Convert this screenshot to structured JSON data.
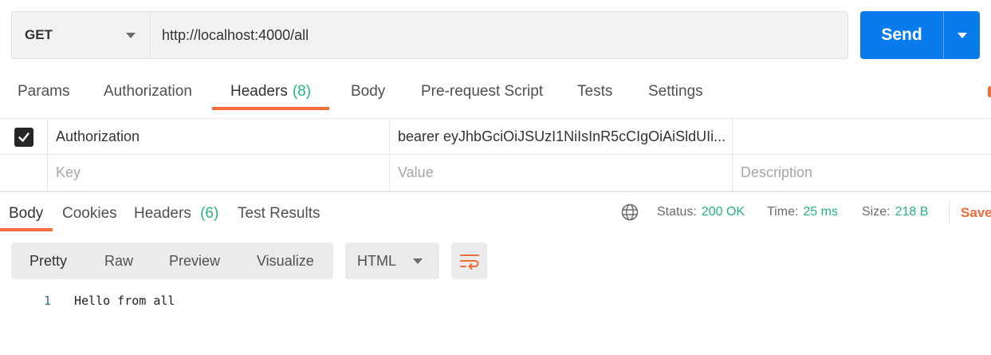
{
  "request": {
    "method": "GET",
    "url": "http://localhost:4000/all",
    "send_label": "Send"
  },
  "request_tabs": [
    {
      "label": "Params"
    },
    {
      "label": "Authorization"
    },
    {
      "label": "Headers",
      "count": "(8)"
    },
    {
      "label": "Body"
    },
    {
      "label": "Pre-request Script"
    },
    {
      "label": "Tests"
    },
    {
      "label": "Settings"
    }
  ],
  "headers_table": {
    "rows": [
      {
        "checked": true,
        "key": "Authorization",
        "value": "bearer eyJhbGciOiJSUzI1NiIsInR5cCIgOiAiSldUIi...",
        "description": ""
      }
    ],
    "placeholders": {
      "key": "Key",
      "value": "Value",
      "description": "Description"
    }
  },
  "response_tabs": [
    {
      "label": "Body"
    },
    {
      "label": "Cookies"
    },
    {
      "label": "Headers",
      "count": "(6)"
    },
    {
      "label": "Test Results"
    }
  ],
  "response_meta": {
    "status_label": "Status:",
    "status_value": "200 OK",
    "time_label": "Time:",
    "time_value": "25 ms",
    "size_label": "Size:",
    "size_value": "218 B",
    "save_label": "Save"
  },
  "format_toolbar": {
    "modes": [
      "Pretty",
      "Raw",
      "Preview",
      "Visualize"
    ],
    "language": "HTML"
  },
  "response_body": {
    "lines": [
      {
        "number": "1",
        "text": "Hello from all"
      }
    ]
  },
  "colors": {
    "accent": "#f26b3a",
    "send": "#097bed",
    "success": "#26b47f"
  }
}
